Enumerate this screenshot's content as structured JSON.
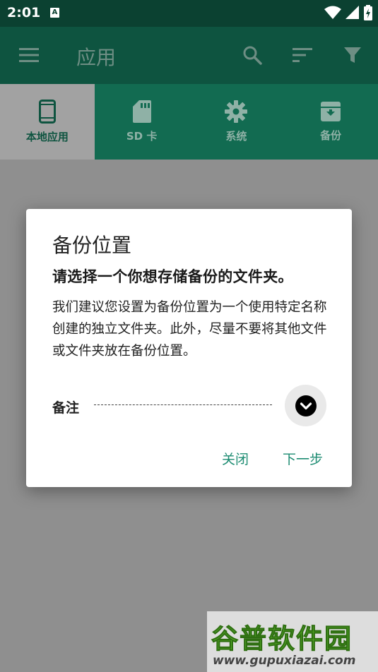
{
  "status_bar": {
    "time": "2:01",
    "notification_badge": "A"
  },
  "toolbar": {
    "title": "应用"
  },
  "tabs": [
    {
      "label": "本地应用",
      "icon": "phone-icon",
      "active": true
    },
    {
      "label": "SD 卡",
      "icon": "sd-card-icon",
      "active": false
    },
    {
      "label": "系统",
      "icon": "gear-icon",
      "active": false
    },
    {
      "label": "备份",
      "icon": "archive-icon",
      "active": false
    }
  ],
  "dialog": {
    "title": "备份位置",
    "subtitle": "请选择一个你想存储备份的文件夹。",
    "body": "我们建议您设置为备份位置为一个使用特定名称创建的独立文件夹。此外，尽量不要将其他文件或文件夹放在备份位置。",
    "note_label": "备注",
    "note_value": "",
    "close_label": "关闭",
    "next_label": "下一步"
  },
  "watermark": {
    "text": "谷普软件园",
    "url": "www.gupuxiazai.com"
  },
  "colors": {
    "status_bar": "#0b4131",
    "toolbar": "#0e5440",
    "tabs": "#126b51",
    "accent": "#1d8c72"
  }
}
